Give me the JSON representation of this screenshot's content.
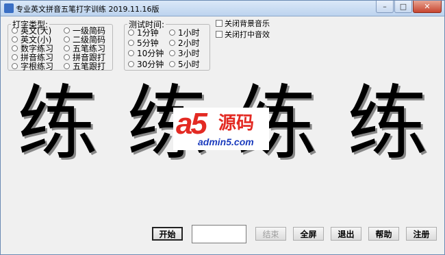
{
  "window": {
    "title": "专业英文拼音五笔打字训练 2019.11.16版",
    "buttons": {
      "minimize": "–",
      "maximize": "□",
      "close": "✕"
    }
  },
  "type_group": {
    "legend": "打字类型:",
    "options": [
      "英文(大)",
      "一级简码",
      "英文(小)",
      "二级简码",
      "数字练习",
      "五笔练习",
      "拼音练习",
      "拼音跟打",
      "字根练习",
      "五笔跟打"
    ]
  },
  "time_group": {
    "legend": "测试时间:",
    "options": [
      "1分钟",
      "1小时",
      "5分钟",
      "2小时",
      "10分钟",
      "3小时",
      "30分钟",
      "5小时"
    ]
  },
  "settings": {
    "bg_music": "关闭背景音乐",
    "typing_sound": "关闭打中音效"
  },
  "display": {
    "chars": [
      "练",
      "练",
      "练",
      "练"
    ]
  },
  "watermark": {
    "brand": "a5",
    "cn": "源码",
    "url": "admin5.com"
  },
  "input": {
    "value": ""
  },
  "buttons": {
    "start": "开始",
    "end": "结束",
    "fullscreen": "全屏",
    "exit": "退出",
    "help": "帮助",
    "register": "注册"
  }
}
